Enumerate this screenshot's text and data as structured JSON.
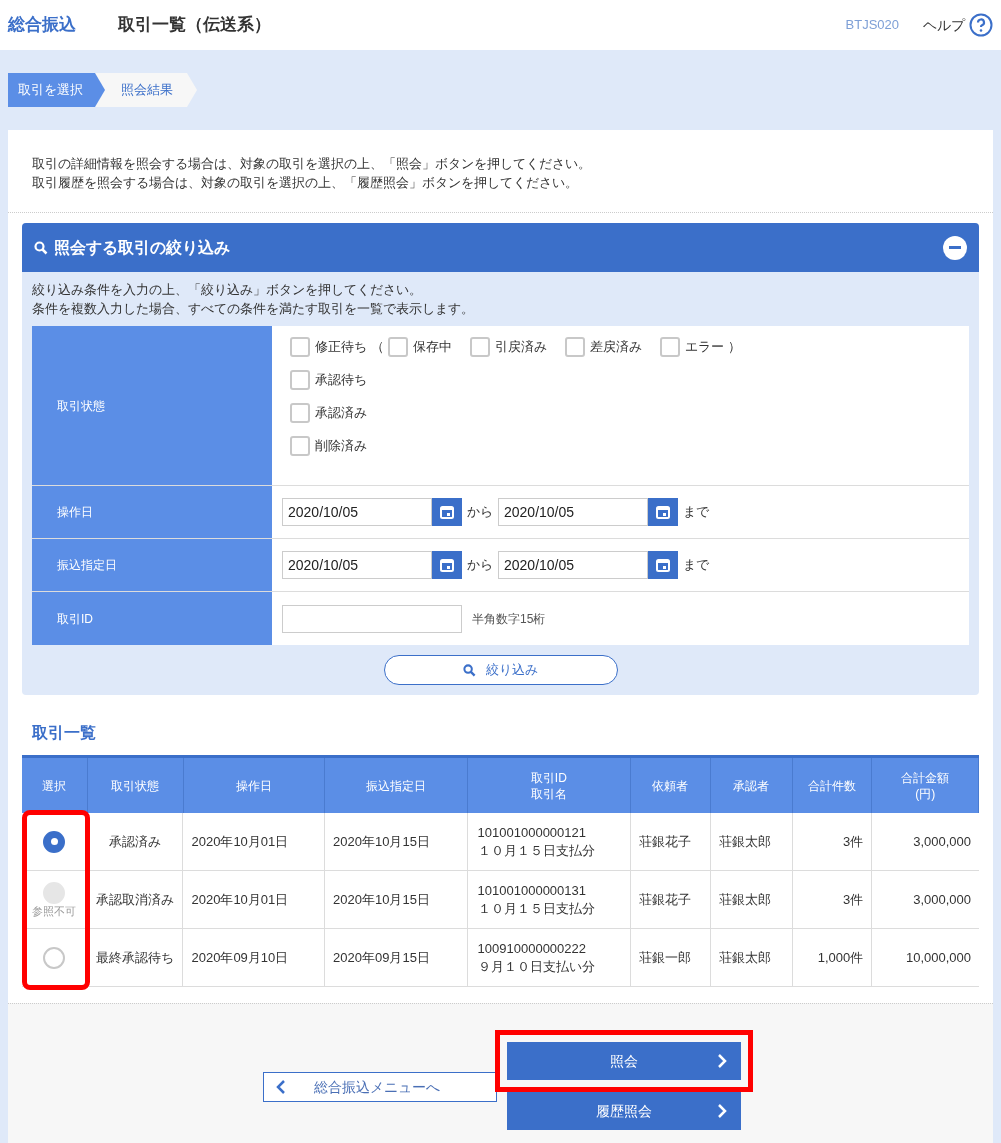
{
  "header": {
    "section": "総合振込",
    "title": "取引一覧（伝送系）",
    "screen_id": "BTJS020",
    "help": "ヘルプ"
  },
  "steps": [
    {
      "label": "取引を選択",
      "selected": true
    },
    {
      "label": "照会結果",
      "selected": false
    }
  ],
  "intro": [
    "取引の詳細情報を照会する場合は、対象の取引を選択の上、「照会」ボタンを押してください。",
    "取引履歴を照会する場合は、対象の取引を選択の上、「履歴照会」ボタンを押してください。"
  ],
  "filter": {
    "title": "照会する取引の絞り込み",
    "expanded": true,
    "instructions": [
      "絞り込み条件を入力の上、「絞り込み」ボタンを押してください。",
      "条件を複数入力した場合、すべての条件を満たす取引を一覧で表示します。"
    ],
    "status": {
      "label": "取引状態",
      "lines": [
        {
          "options": [
            {
              "label": "修正待ち",
              "checked": false
            }
          ],
          "sub_group": {
            "open": "（",
            "close": "）",
            "options": [
              {
                "label": "保存中",
                "checked": false
              },
              {
                "label": "引戻済み",
                "checked": false
              },
              {
                "label": "差戻済み",
                "checked": false
              },
              {
                "label": "エラー",
                "checked": false
              }
            ]
          }
        },
        {
          "options": [
            {
              "label": "承認待ち",
              "checked": false
            }
          ]
        },
        {
          "options": [
            {
              "label": "承認済み",
              "checked": false
            }
          ]
        },
        {
          "options": [
            {
              "label": "削除済み",
              "checked": false
            }
          ]
        }
      ]
    },
    "date_rows": [
      {
        "label": "操作日",
        "from": "2020/10/05",
        "between": "から",
        "to": "2020/10/05",
        "after": "まで"
      },
      {
        "label": "振込指定日",
        "from": "2020/10/05",
        "between": "から",
        "to": "2020/10/05",
        "after": "まで"
      }
    ],
    "id_row": {
      "label": "取引ID",
      "hint": "半角数字15桁"
    },
    "button": "絞り込み"
  },
  "list": {
    "title": "取引一覧",
    "select_column_highlighted": true,
    "columns": [
      [
        "選択"
      ],
      [
        "取引状態"
      ],
      [
        "操作日"
      ],
      [
        "振込指定日"
      ],
      [
        "取引ID",
        "取引名"
      ],
      [
        "依頼者"
      ],
      [
        "承認者"
      ],
      [
        "合計件数"
      ],
      [
        "合計金額",
        "(円)"
      ]
    ],
    "rows": [
      {
        "selected": true,
        "disabled": false,
        "status": "承認済み",
        "op_date": "2020年10月01日",
        "transfer_date": "2020年10月15日",
        "id": "101001000000121",
        "name": "１０月１５日支払分",
        "requester": "荘銀花子",
        "approver": "荘銀太郎",
        "count": "3件",
        "amount": "3,000,000"
      },
      {
        "selected": false,
        "disabled": true,
        "note": "参照不可",
        "status": "承認取消済み",
        "op_date": "2020年10月01日",
        "transfer_date": "2020年10月15日",
        "id": "101001000000131",
        "name": "１０月１５日支払分",
        "requester": "荘銀花子",
        "approver": "荘銀太郎",
        "count": "3件",
        "amount": "3,000,000"
      },
      {
        "selected": false,
        "disabled": false,
        "status": "最終承認待ち",
        "op_date": "2020年09月10日",
        "transfer_date": "2020年09月15日",
        "id": "100910000000222",
        "name": "９月１０日支払い分",
        "requester": "荘銀一郎",
        "approver": "荘銀太郎",
        "count": "1,000件",
        "amount": "10,000,000"
      }
    ]
  },
  "footer": {
    "back": "総合振込メニューへ",
    "actions": [
      {
        "label": "照会",
        "highlighted": true
      },
      {
        "label": "履歴照会",
        "highlighted": false
      }
    ]
  }
}
